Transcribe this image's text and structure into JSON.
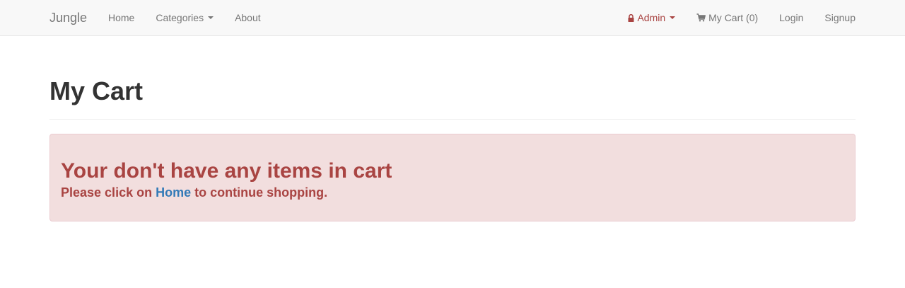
{
  "navbar": {
    "brand": "Jungle",
    "left_items": [
      {
        "label": "Home"
      },
      {
        "label": "Categories",
        "dropdown": true
      },
      {
        "label": "About"
      }
    ],
    "admin": {
      "label": "Admin",
      "icon": "lock-icon",
      "color": "#a94442"
    },
    "cart": {
      "label": "My Cart (0)",
      "icon": "shopping-cart-icon"
    },
    "login": "Login",
    "signup": "Signup"
  },
  "page": {
    "title": "My Cart"
  },
  "alert": {
    "heading": "Your don't have any items in cart",
    "text_before": "Please click on ",
    "link_label": "Home",
    "text_after": " to continue shopping.",
    "background": "#f2dede",
    "color": "#a94442",
    "link_color": "#337ab7"
  }
}
